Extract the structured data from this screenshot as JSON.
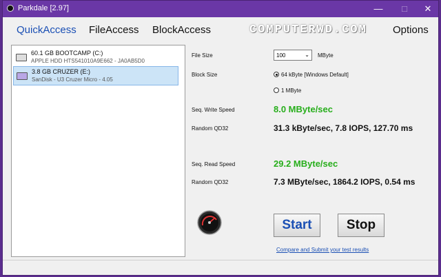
{
  "window": {
    "title": "Parkdale [2.97]",
    "minimize": "—",
    "maximize": "□",
    "close": "✕"
  },
  "menu": {
    "quick": "QuickAccess",
    "file": "FileAccess",
    "block": "BlockAccess",
    "options": "Options"
  },
  "watermark": "COMPUTERWD.COM",
  "drives": [
    {
      "name": "60.1 GB BOOTCAMP (C:)",
      "detail": "APPLE HDD HTS541010A9E662 - JA0AB5D0",
      "selected": false
    },
    {
      "name": "3.8 GB CRUZER (E:)",
      "detail": "SanDisk - U3 Cruzer Micro - 4.05",
      "selected": true
    }
  ],
  "settings": {
    "file_size_label": "File Size",
    "file_size_value": "100",
    "file_size_unit": "MByte",
    "block_size_label": "Block Size",
    "block_opt1": "64 kByte [Windows Default]",
    "block_opt2": "1 MByte",
    "block_selected": "64 kByte [Windows Default]"
  },
  "results": {
    "seq_write_label": "Seq. Write Speed",
    "seq_write_value": "8.0 MByte/sec",
    "rand_write_label": "Random QD32",
    "rand_write_value": "31.3 kByte/sec, 7.8 IOPS, 127.70 ms",
    "seq_read_label": "Seq. Read Speed",
    "seq_read_value": "29.2 MByte/sec",
    "rand_read_label": "Random QD32",
    "rand_read_value": "7.3 MByte/sec, 1864.2 IOPS, 0.54 ms"
  },
  "actions": {
    "start": "Start",
    "stop": "Stop",
    "compare_link": "Compare and Submit your test results"
  },
  "icons": {
    "gauge": "speedometer-icon",
    "drive": "hard-drive-icon",
    "usb": "usb-drive-icon"
  },
  "colors": {
    "titlebar": "#6a37a6",
    "accent_blue": "#1a4fb4",
    "result_green": "#27ae1b"
  }
}
